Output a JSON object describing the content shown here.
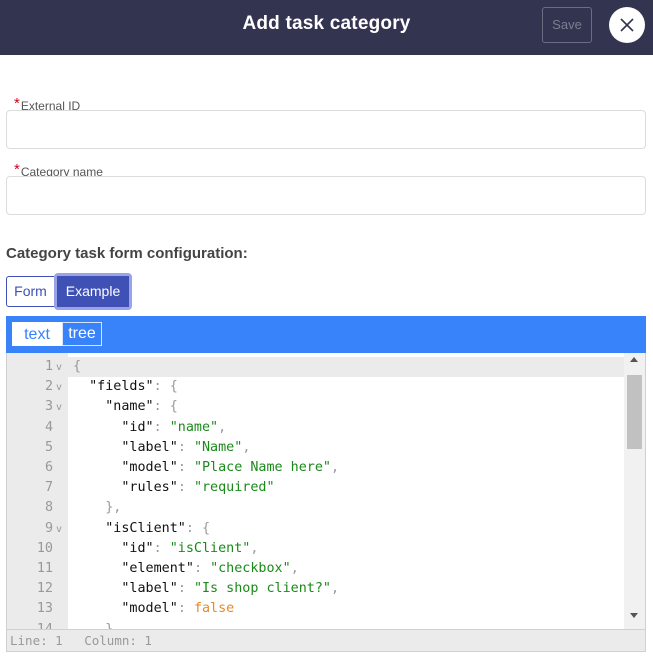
{
  "header": {
    "title": "Add task category",
    "save_label": "Save",
    "close_icon": "close-icon"
  },
  "form": {
    "external_id": {
      "required_mark": "*",
      "label": "External ID",
      "value": ""
    },
    "category_name": {
      "required_mark": "*",
      "label": "Category name",
      "value": ""
    }
  },
  "section": {
    "title": "Category task form configuration:"
  },
  "toggle": {
    "form_label": "Form",
    "example_label": "Example"
  },
  "editor": {
    "modes": {
      "text": "text",
      "tree": "tree"
    },
    "lines": [
      {
        "n": "1",
        "fold": true,
        "indent": "",
        "tokens": [
          {
            "t": "{",
            "c": "p"
          }
        ]
      },
      {
        "n": "2",
        "fold": true,
        "indent": "  ",
        "tokens": [
          {
            "t": "\"fields\"",
            "c": "k"
          },
          {
            "t": ": {",
            "c": "p"
          }
        ]
      },
      {
        "n": "3",
        "fold": true,
        "indent": "    ",
        "tokens": [
          {
            "t": "\"name\"",
            "c": "k"
          },
          {
            "t": ": {",
            "c": "p"
          }
        ]
      },
      {
        "n": "4",
        "fold": false,
        "indent": "      ",
        "tokens": [
          {
            "t": "\"id\"",
            "c": "k"
          },
          {
            "t": ": ",
            "c": "p"
          },
          {
            "t": "\"name\"",
            "c": "s"
          },
          {
            "t": ",",
            "c": "p"
          }
        ]
      },
      {
        "n": "5",
        "fold": false,
        "indent": "      ",
        "tokens": [
          {
            "t": "\"label\"",
            "c": "k"
          },
          {
            "t": ": ",
            "c": "p"
          },
          {
            "t": "\"Name\"",
            "c": "s"
          },
          {
            "t": ",",
            "c": "p"
          }
        ]
      },
      {
        "n": "6",
        "fold": false,
        "indent": "      ",
        "tokens": [
          {
            "t": "\"model\"",
            "c": "k"
          },
          {
            "t": ": ",
            "c": "p"
          },
          {
            "t": "\"Place Name here\"",
            "c": "s"
          },
          {
            "t": ",",
            "c": "p"
          }
        ]
      },
      {
        "n": "7",
        "fold": false,
        "indent": "      ",
        "tokens": [
          {
            "t": "\"rules\"",
            "c": "k"
          },
          {
            "t": ": ",
            "c": "p"
          },
          {
            "t": "\"required\"",
            "c": "s"
          }
        ]
      },
      {
        "n": "8",
        "fold": false,
        "indent": "    ",
        "tokens": [
          {
            "t": "},",
            "c": "p"
          }
        ]
      },
      {
        "n": "9",
        "fold": true,
        "indent": "    ",
        "tokens": [
          {
            "t": "\"isClient\"",
            "c": "k"
          },
          {
            "t": ": {",
            "c": "p"
          }
        ]
      },
      {
        "n": "10",
        "fold": false,
        "indent": "      ",
        "tokens": [
          {
            "t": "\"id\"",
            "c": "k"
          },
          {
            "t": ": ",
            "c": "p"
          },
          {
            "t": "\"isClient\"",
            "c": "s"
          },
          {
            "t": ",",
            "c": "p"
          }
        ]
      },
      {
        "n": "11",
        "fold": false,
        "indent": "      ",
        "tokens": [
          {
            "t": "\"element\"",
            "c": "k"
          },
          {
            "t": ": ",
            "c": "p"
          },
          {
            "t": "\"checkbox\"",
            "c": "s"
          },
          {
            "t": ",",
            "c": "p"
          }
        ]
      },
      {
        "n": "12",
        "fold": false,
        "indent": "      ",
        "tokens": [
          {
            "t": "\"label\"",
            "c": "k"
          },
          {
            "t": ": ",
            "c": "p"
          },
          {
            "t": "\"Is shop client?\"",
            "c": "s"
          },
          {
            "t": ",",
            "c": "p"
          }
        ]
      },
      {
        "n": "13",
        "fold": false,
        "indent": "      ",
        "tokens": [
          {
            "t": "\"model\"",
            "c": "k"
          },
          {
            "t": ": ",
            "c": "p"
          },
          {
            "t": "false",
            "c": "b"
          }
        ]
      },
      {
        "n": "14",
        "fold": false,
        "indent": "    ",
        "tokens": [
          {
            "t": "}",
            "c": "p"
          }
        ]
      }
    ],
    "status": {
      "line": "Line: 1",
      "column": "Column: 1"
    }
  },
  "colors": {
    "header_bg": "#33344f",
    "accent": "#3f51b5",
    "editor_bar": "#3883fa",
    "string": "#1a8a1a",
    "boolean": "#e48a2a",
    "required": "#d0021b"
  }
}
